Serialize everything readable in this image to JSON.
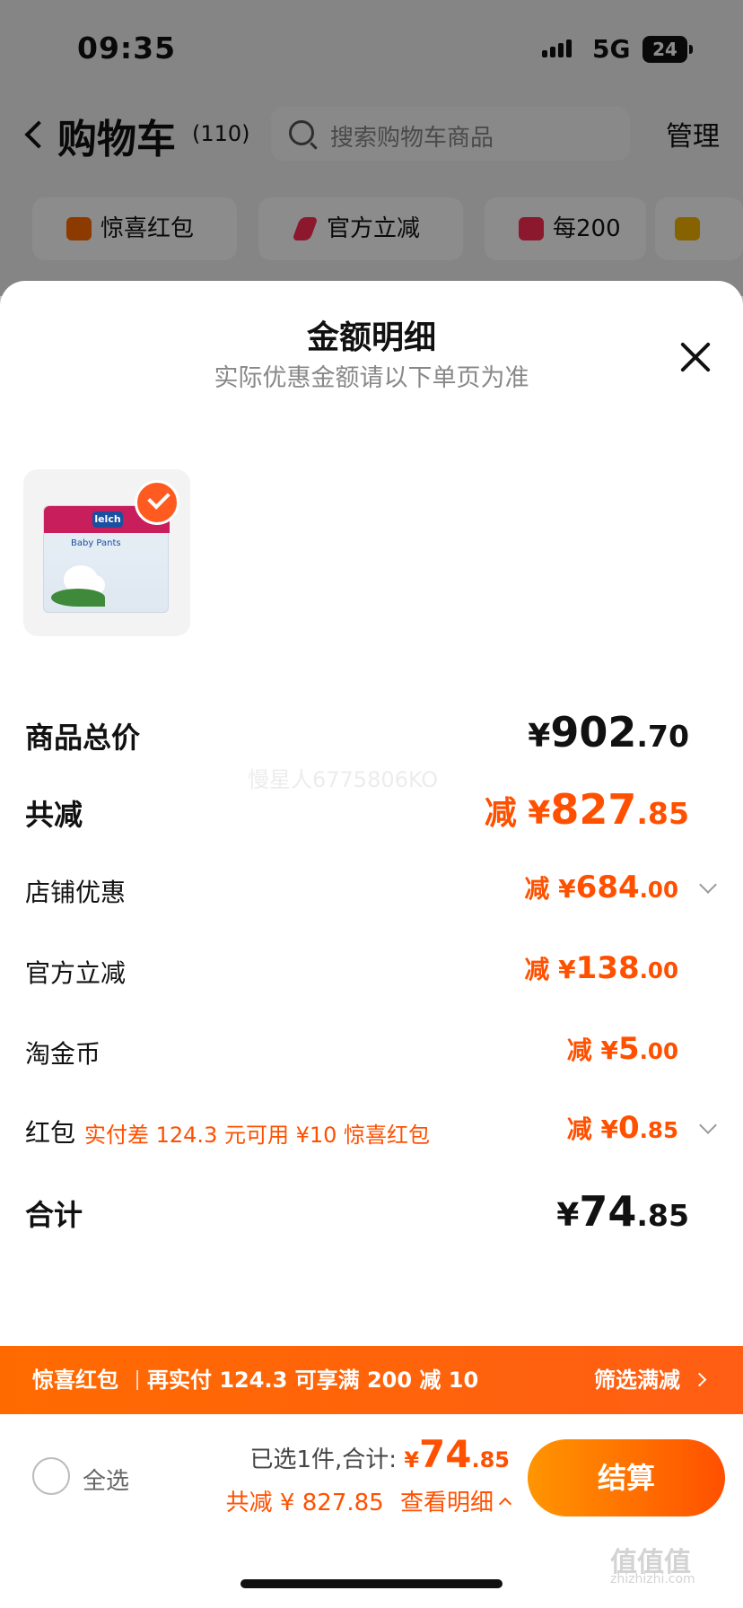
{
  "status": {
    "time": "09:35",
    "network": "5G",
    "battery": "24"
  },
  "cart": {
    "title": "购物车",
    "count": "(110)",
    "search_placeholder": "搜索购物车商品",
    "manage": "管理",
    "chips": [
      "惊喜红包",
      "官方立减",
      "每200"
    ],
    "chip_colors": [
      "#ff6a00",
      "#ff2d55",
      "#ff2d55",
      "#f5b400"
    ]
  },
  "sheet": {
    "title": "金额明细",
    "subtitle": "实际优惠金额请以下单页为准",
    "watermark": "慢星人6775806KO",
    "rows": {
      "total_price": {
        "label": "商品总价",
        "prefix": "¥",
        "int": "902",
        "dec": ".70"
      },
      "total_discount": {
        "label": "共减",
        "prefix": "减 ¥",
        "int": "827",
        "dec": ".85"
      },
      "store_discount": {
        "label": "店铺优惠",
        "prefix": "减 ¥",
        "int": "684",
        "dec": ".00"
      },
      "official_discount": {
        "label": "官方立减",
        "prefix": "减 ¥",
        "int": "138",
        "dec": ".00"
      },
      "taojinbi": {
        "label": "淘金币",
        "prefix": "减 ¥",
        "int": "5",
        "dec": ".00"
      },
      "red_packet": {
        "label": "红包",
        "note": "实付差 124.3 元可用 ¥10 惊喜红包",
        "prefix": "减 ¥",
        "int": "0",
        "dec": ".85"
      },
      "subtotal": {
        "label": "合计",
        "prefix": "¥",
        "int": "74",
        "dec": ".85"
      }
    }
  },
  "promo": {
    "left": "惊喜红包",
    "mid": "再实付 124.3 可享满 200 减 10",
    "link": "筛选满减"
  },
  "bottom": {
    "select_all": "全选",
    "selected_text": "已选1件,合计:",
    "amount_prefix": "¥",
    "amount_int": "74",
    "amount_dec": ".85",
    "discount_text": "共减 ¥ 827.85",
    "detail_link": "查看明细",
    "checkout": "结算",
    "corner_mark": "值值值",
    "corner_sub": "zhizhizhi.com"
  },
  "colors": {
    "accent": "#ff5000",
    "promo_bg": "#ff6a00"
  }
}
